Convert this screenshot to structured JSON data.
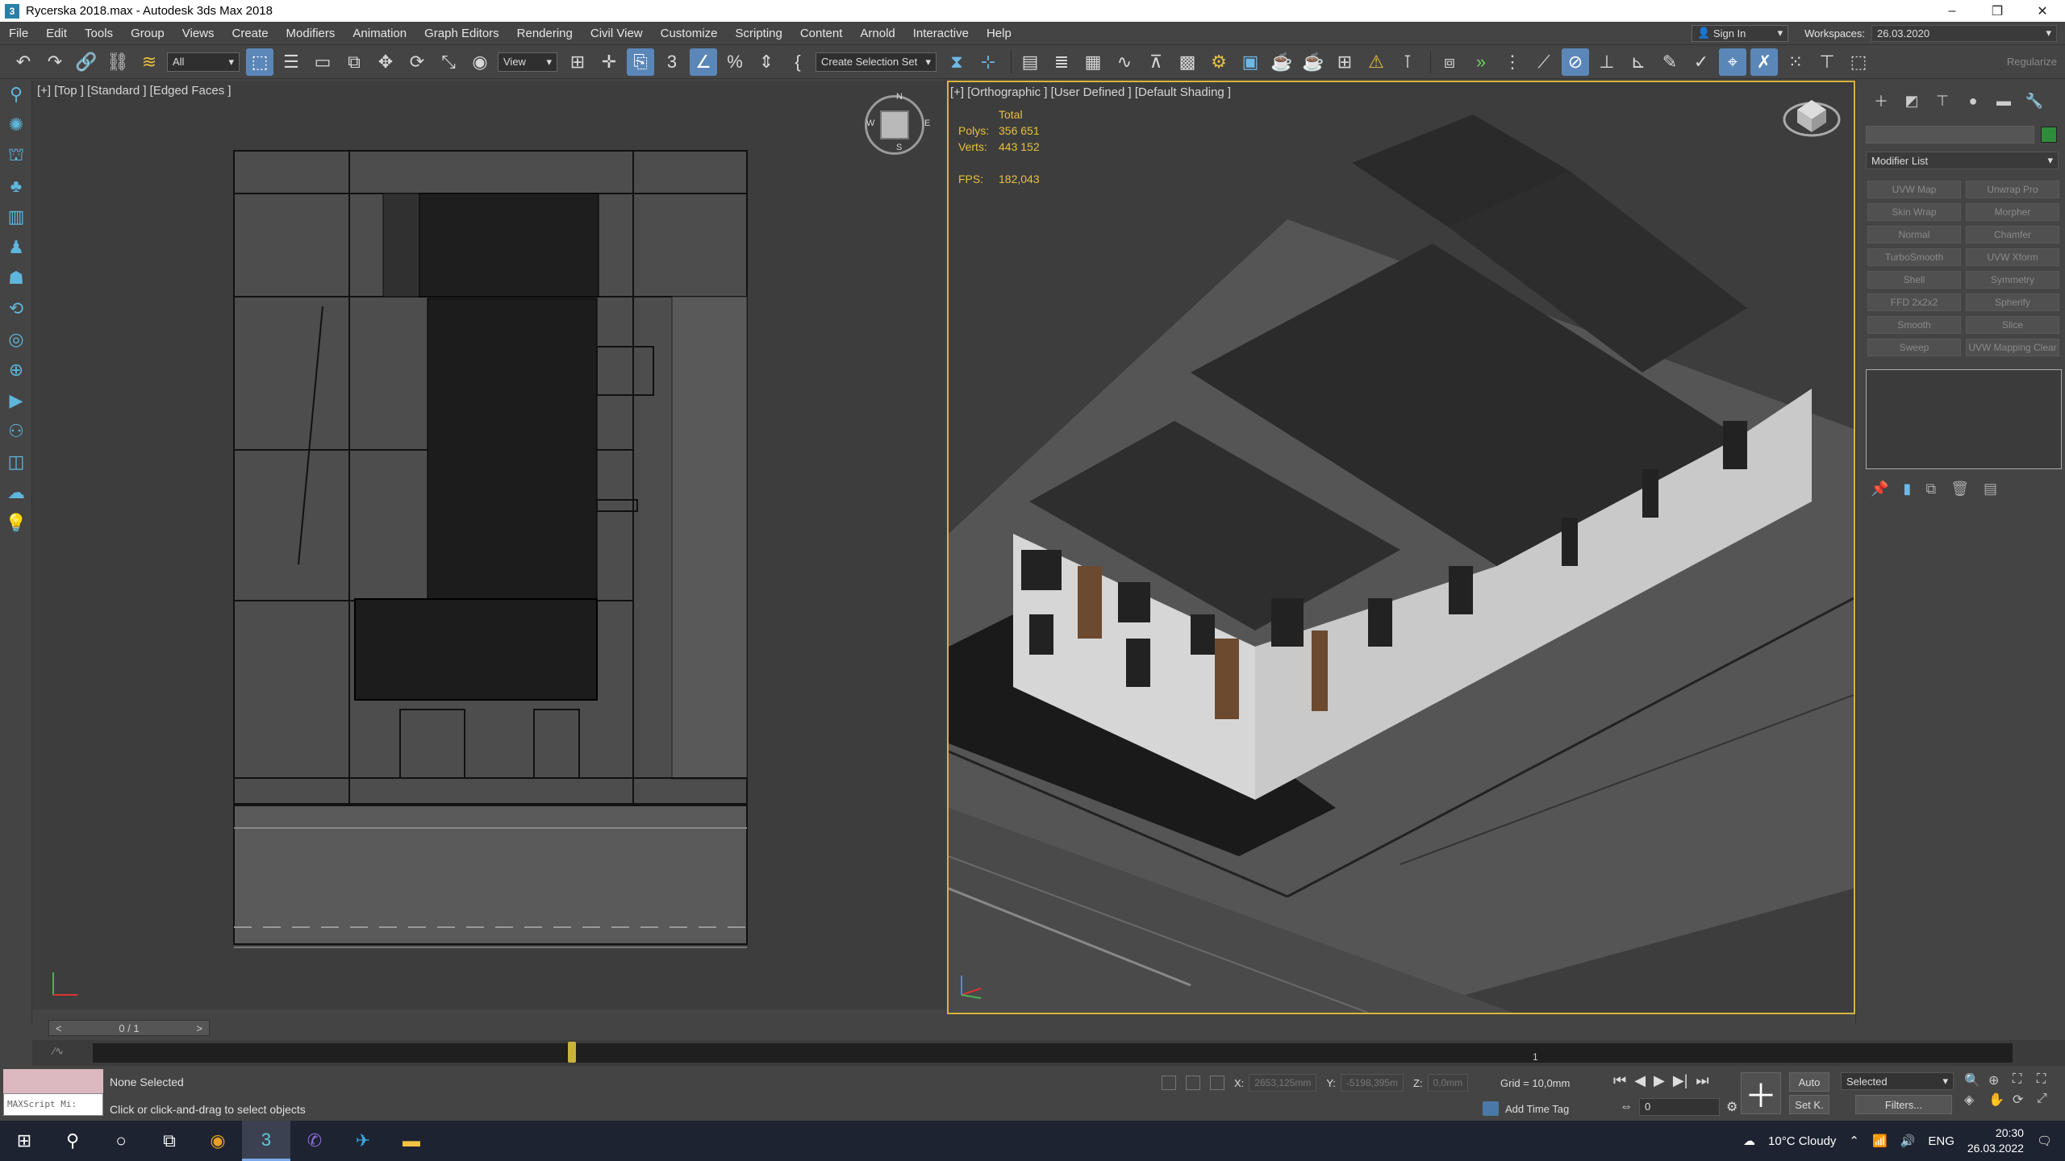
{
  "titlebar": {
    "title": "Rycerska 2018.max - Autodesk 3ds Max 2018",
    "minimize": "–",
    "restore": "❐",
    "close": "✕"
  },
  "menu": {
    "items": [
      "File",
      "Edit",
      "Tools",
      "Group",
      "Views",
      "Create",
      "Modifiers",
      "Animation",
      "Graph Editors",
      "Rendering",
      "Civil View",
      "Customize",
      "Scripting",
      "Content",
      "Arnold",
      "Interactive",
      "Help"
    ],
    "signin": "Sign In",
    "workspaces_label": "Workspaces:",
    "workspaces_value": "26.03.2020"
  },
  "toolbar": {
    "filter_value": "All",
    "refcoord_value": "View",
    "selection_set_value": "Create Selection Set",
    "regularize": "Regularize"
  },
  "viewports": {
    "left_label": "[+] [Top ] [Standard ] [Edged Faces ]",
    "right_label": "[+] [Orthographic ] [User Defined ] [Default Shading ]",
    "stats": {
      "total_label": "Total",
      "polys_label": "Polys:",
      "polys_value": "356 651",
      "verts_label": "Verts:",
      "verts_value": "443 152",
      "fps_label": "FPS:",
      "fps_value": "182,043"
    },
    "compass": {
      "n": "N",
      "s": "S",
      "w": "W",
      "e": "E"
    }
  },
  "command_panel": {
    "modifier_list": "Modifier List",
    "modifiers": [
      "UVW Map",
      "Unwrap Pro",
      "Skin Wrap",
      "Morpher",
      "Normal",
      "Chamfer",
      "TurboSmooth",
      "UVW Xform",
      "Shell",
      "Symmetry",
      "FFD 2x2x2",
      "Spherify",
      "Smooth",
      "Slice",
      "Sweep",
      "UVW Mapping Clear"
    ]
  },
  "timeline": {
    "frame_counter": "0 / 1",
    "ruler_end": "1"
  },
  "status": {
    "maxscript": "MAXScript Mi:",
    "selection": "None Selected",
    "hint": "Click or click-and-drag to select objects",
    "x_label": "X:",
    "x_value": "2653,125mm",
    "y_label": "Y:",
    "y_value": "-5198,395m",
    "z_label": "Z:",
    "z_value": "0,0mm",
    "grid": "Grid = 10,0mm",
    "add_time_tag": "Add Time Tag",
    "auto": "Auto",
    "set_k": "Set K.",
    "selected": "Selected",
    "filters": "Filters...",
    "frame": "0"
  },
  "taskbar": {
    "weather": "10°C  Cloudy",
    "lang": "ENG",
    "time": "20:30",
    "date": "26.03.2022"
  }
}
